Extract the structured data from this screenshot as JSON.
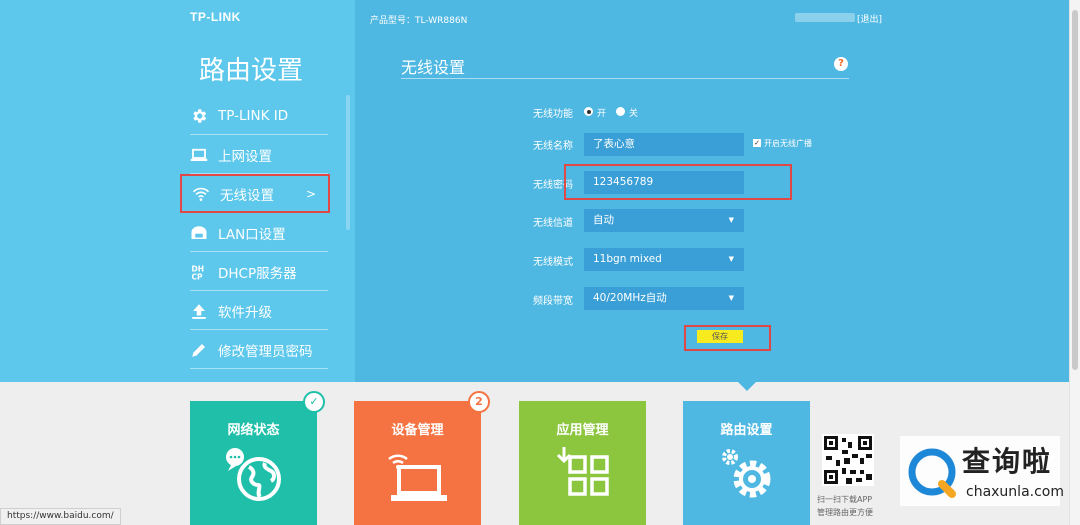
{
  "brand": {
    "logo": "TP-LINK"
  },
  "header": {
    "model": "产品型号：TL-WR886N",
    "logout": "[退出]"
  },
  "sidebar": {
    "heading": "路由设置",
    "items": [
      {
        "label": "TP-LINK ID",
        "icon": "gear-icon"
      },
      {
        "label": "上网设置",
        "icon": "laptop-icon"
      },
      {
        "label": "无线设置",
        "icon": "wifi-icon",
        "active": true,
        "arrow": ">"
      },
      {
        "label": "LAN口设置",
        "icon": "lan-icon"
      },
      {
        "label": "DHCP服务器",
        "icon": "dhcp-icon"
      },
      {
        "label": "软件升级",
        "icon": "upload-icon"
      },
      {
        "label": "修改管理员密码",
        "icon": "pencil-icon"
      }
    ]
  },
  "main": {
    "title": "无线设置",
    "help": "?",
    "wireless_func": {
      "label": "无线功能",
      "on": "开",
      "off": "关",
      "selected": "on"
    },
    "ssid": {
      "label": "无线名称",
      "value": "了表心意"
    },
    "broadcast": {
      "label": "开启无线广播",
      "checked": true
    },
    "password": {
      "label": "无线密码",
      "value": "123456789"
    },
    "channel": {
      "label": "无线信道",
      "value": "自动"
    },
    "mode": {
      "label": "无线模式",
      "value": "11bgn mixed"
    },
    "bandwidth": {
      "label": "频段带宽",
      "value": "40/20MHz自动"
    },
    "save": "保存"
  },
  "tiles": {
    "network": "网络状态",
    "device": "设备管理",
    "device_badge": "2",
    "app": "应用管理",
    "router": "路由设置"
  },
  "qr": {
    "caption1": "扫一扫下载APP",
    "caption2": "管理路由更方便"
  },
  "watermark": {
    "text": "查询啦",
    "sub": "chaxunla.com"
  },
  "statusbar": {
    "url": "https://www.baidu.com/"
  },
  "colors": {
    "panel_light": "#5dc8ec",
    "panel": "#4fb8e2",
    "field": "#3a9fd6",
    "highlight": "#e04848",
    "save": "#f7ea1f"
  }
}
